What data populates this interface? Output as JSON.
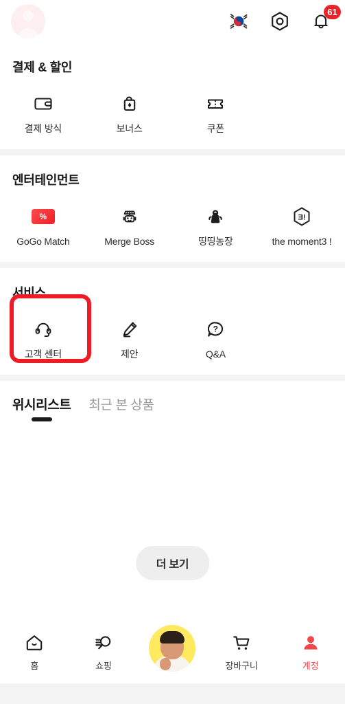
{
  "header": {
    "avatar_name": "profile-avatar-placeholder",
    "flag_label": "Korea flag",
    "settings_label": "settings",
    "notifications_label": "notifications",
    "notification_badge": "61"
  },
  "sections": [
    {
      "title": "결제 & 할인",
      "items": [
        {
          "label": "결제 방식",
          "icon": "wallet-icon"
        },
        {
          "label": "보너스",
          "icon": "gift-bag-icon"
        },
        {
          "label": "쿠폰",
          "icon": "ticket-icon"
        }
      ]
    },
    {
      "title": "엔터테인먼트",
      "items": [
        {
          "label": "GoGo Match",
          "icon": "percent-card-icon"
        },
        {
          "label": "Merge Boss",
          "icon": "robot-icon"
        },
        {
          "label": "띵띵농장",
          "icon": "farm-animal-icon"
        },
        {
          "label": "the moment3 !",
          "icon": "hexagon-3-icon"
        }
      ]
    },
    {
      "title": "서비스",
      "items": [
        {
          "label": "고객 센터",
          "icon": "headset-icon",
          "highlighted": true
        },
        {
          "label": "제안",
          "icon": "pencil-icon"
        },
        {
          "label": "Q&A",
          "icon": "question-bubble-icon"
        }
      ]
    }
  ],
  "tabs": [
    {
      "label": "위시리스트",
      "active": true
    },
    {
      "label": "최근 본 상품",
      "active": false
    }
  ],
  "more_button": {
    "label": "더 보기"
  },
  "bottom_nav": [
    {
      "label": "홈",
      "icon": "home-icon",
      "active": false
    },
    {
      "label": "쇼핑",
      "icon": "search-shop-icon",
      "active": false
    },
    {
      "label": "",
      "icon": "user-photo-avatar",
      "active": false
    },
    {
      "label": "장바구니",
      "icon": "cart-icon",
      "active": false
    },
    {
      "label": "계정",
      "icon": "person-icon",
      "active": true
    }
  ],
  "colors": {
    "accent_red": "#f0474b",
    "badge_red": "#e8242a",
    "highlight_red": "#ef1c25",
    "divider_gray": "#f4f4f5",
    "more_btn_bg": "#eeeeef",
    "avatar_yellow": "#ffe95e"
  }
}
